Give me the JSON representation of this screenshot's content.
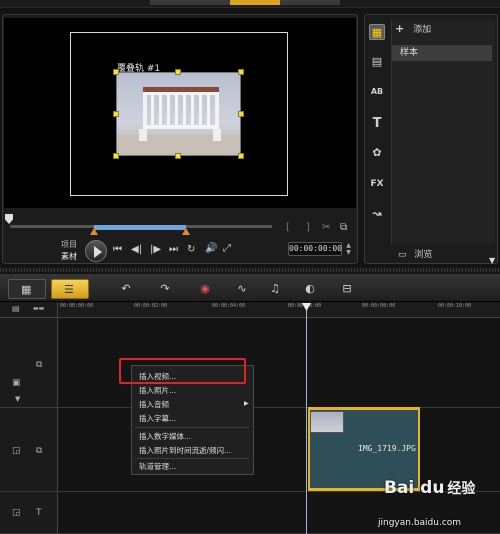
{
  "preview": {
    "overlay_label": "覆叠轨 #1",
    "mode_project": "项目",
    "mode_clip": "素材",
    "timecode": "00:00:00:00",
    "transport": [
      "⏮",
      "◀|",
      "|▶",
      "⏭",
      "↻",
      "🔊",
      "⤢"
    ],
    "mark_in": "[",
    "mark_out": "]"
  },
  "library": {
    "add_label": "添加",
    "sample_label": "样本",
    "browse_label": "浏览",
    "icons": [
      "media-icon",
      "instant-project-icon",
      "transition-icon",
      "title-icon",
      "graphic-icon",
      "filter-icon",
      "path-icon"
    ],
    "icon_glyphs": [
      "▦",
      "▤",
      "AB",
      "T",
      "✿",
      "FX",
      "↝"
    ]
  },
  "toolbar": {
    "icons": [
      "undo-icon",
      "redo-icon",
      "record-capture-icon",
      "sound-mixer-icon",
      "auto-music-icon",
      "motion-track-icon",
      "subtitle-editor-icon"
    ],
    "glyphs": [
      "↶",
      "↷",
      "◉",
      "∿",
      "♫",
      "◐",
      "⊟"
    ]
  },
  "ruler": {
    "ticks": [
      "00:00:00:00",
      "00:00:02:00",
      "00:00:04:00",
      "00:00:06:00",
      "00:00:08:00",
      "00:00:10:00"
    ]
  },
  "timeline": {
    "clip_label": "IMG_1719.JPG"
  },
  "context_menu": {
    "items": [
      {
        "label": "插入视频..."
      },
      {
        "label": "插入照片..."
      },
      {
        "label": "插入音频",
        "arrow": "▶"
      },
      {
        "label": "插入字幕..."
      },
      {
        "label": "插入数字媒体..."
      },
      {
        "label": "插入照片到时间流逝/频闪..."
      },
      {
        "label": "轨道管理..."
      }
    ]
  },
  "watermark": {
    "logo": "Bai du",
    "cn": "经验",
    "url": "jingyan.baidu.com"
  },
  "colors": {
    "accent_yellow": "#ffe400",
    "clip_border": "#e6b422",
    "highlight_red": "#e0222e",
    "clip_fill": "#2f4f58"
  }
}
